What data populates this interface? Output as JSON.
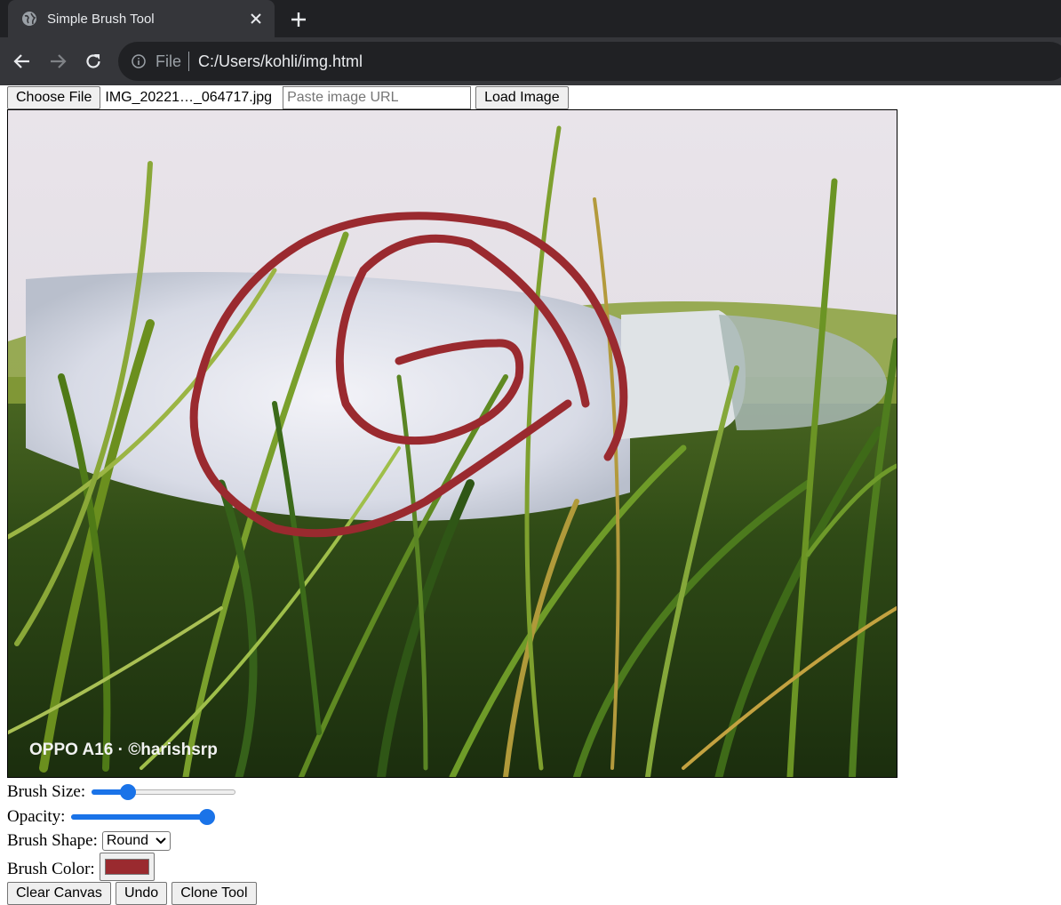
{
  "browser": {
    "tab_title": "Simple Brush Tool",
    "url_scheme": "File",
    "url": "C:/Users/kohli/img.html",
    "icons": [
      "globe-icon",
      "close-icon",
      "plus-icon",
      "back-arrow-icon",
      "forward-arrow-icon",
      "reload-icon",
      "info-icon"
    ]
  },
  "top_controls": {
    "choose_file_label": "Choose File",
    "file_name": "IMG_20221…_064717.jpg",
    "url_placeholder": "Paste image URL",
    "url_value": "",
    "load_image_label": "Load Image"
  },
  "canvas": {
    "watermark": "OPPO A16 · ©harishsrp",
    "stroke_color": "#9a2a2f"
  },
  "controls": {
    "brush_size_label": "Brush Size:",
    "brush_size_value": 0.22,
    "opacity_label": "Opacity:",
    "opacity_value": 1.0,
    "brush_shape_label": "Brush Shape:",
    "brush_shape_selected": "Round",
    "brush_color_label": "Brush Color:",
    "brush_color": "#9a2a2f"
  },
  "bottom_buttons": {
    "clear_label": "Clear Canvas",
    "undo_label": "Undo",
    "clone_label": "Clone Tool"
  },
  "colors": {
    "chrome_dark": "#202124",
    "chrome_tab": "#35363a",
    "slider_accent": "#1a73e8"
  }
}
